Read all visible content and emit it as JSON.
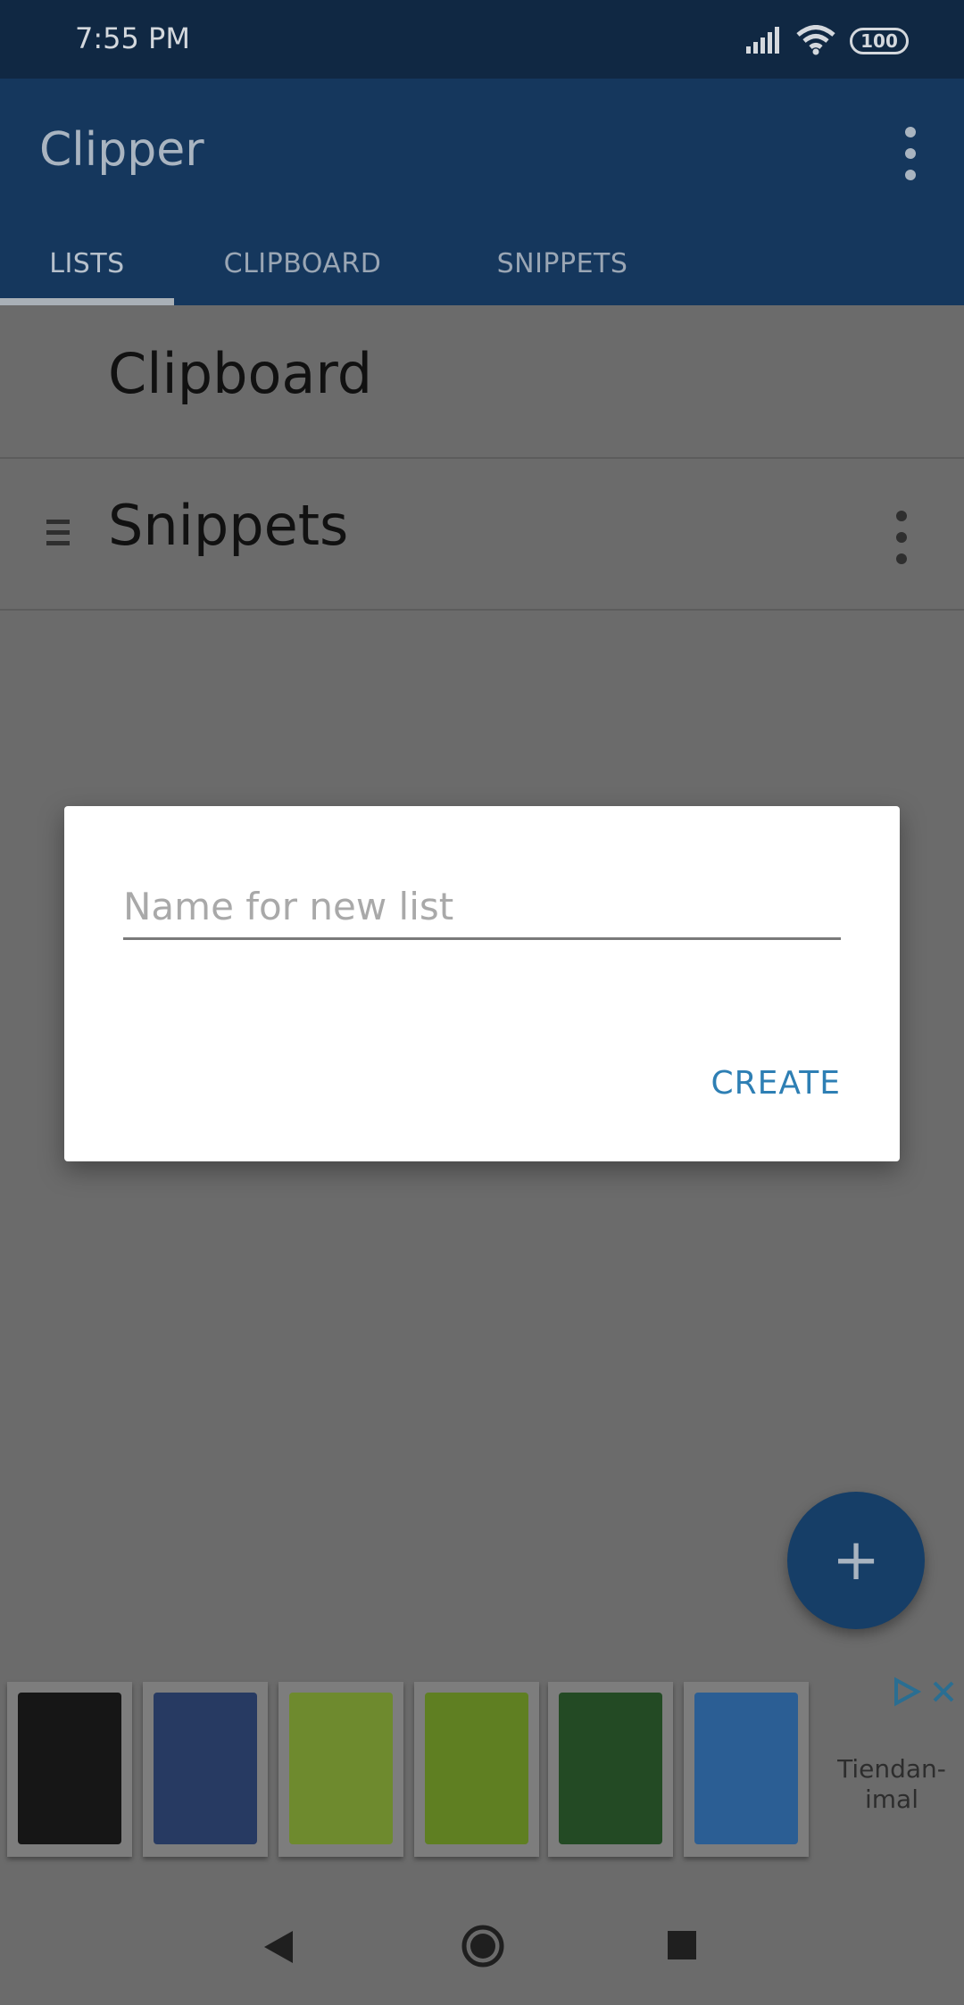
{
  "status_bar": {
    "time": "7:55 PM",
    "battery": "100",
    "icons": [
      "signal-icon",
      "wifi-icon",
      "battery-icon"
    ]
  },
  "app_bar": {
    "title": "Clipper",
    "menu_icon": "overflow-menu-icon",
    "tabs": [
      {
        "label": "LISTS",
        "selected": true
      },
      {
        "label": "CLIPBOARD",
        "selected": false
      },
      {
        "label": "SNIPPETS",
        "selected": false
      }
    ]
  },
  "lists": [
    {
      "label": "Clipboard"
    },
    {
      "label": "Snippets",
      "icons": [
        "drag-handle-icon",
        "overflow-menu-icon"
      ]
    }
  ],
  "dialog": {
    "input_placeholder": "Name for new list",
    "input_value": "",
    "create_label": "CREATE"
  },
  "fab": {
    "icon": "plus-icon"
  },
  "ad": {
    "label": "Tiendan-\nimal",
    "icons": [
      "ad-choices-icon",
      "close-icon"
    ],
    "product_colors": [
      "#161616",
      "#273a62",
      "#6e8a2e",
      "#5f7f22",
      "#234a24",
      "#2b5e94"
    ]
  },
  "nav_bar": {
    "icons": [
      "back-icon",
      "home-icon",
      "recents-icon"
    ]
  },
  "colors": {
    "accent": "#2e7fb4",
    "app_bar": "#15375d",
    "status_bar": "#102843",
    "scrim": "#6b6b6b"
  }
}
